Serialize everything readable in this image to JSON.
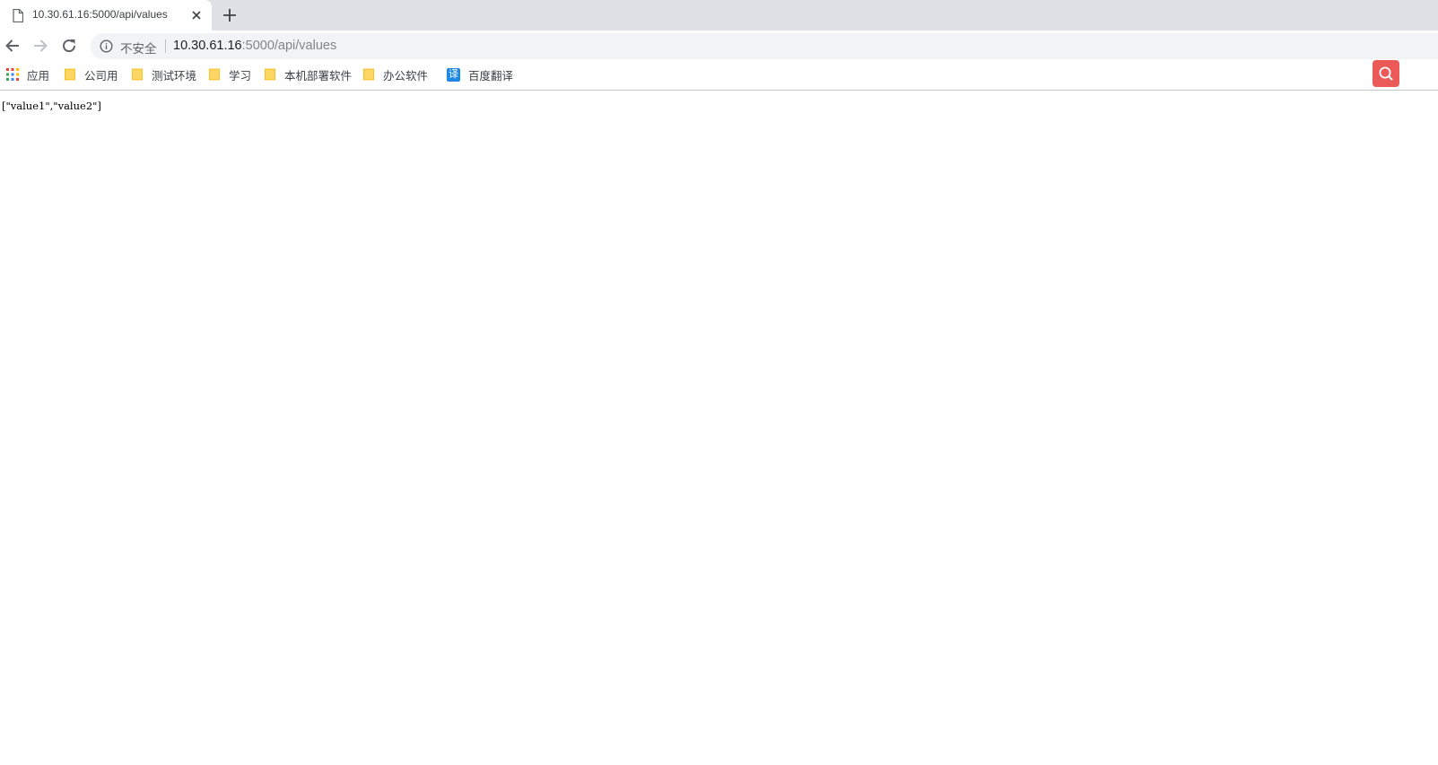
{
  "tab": {
    "title": "10.30.61.16:5000/api/values",
    "favicon": "page-icon",
    "close_icon": "close-icon"
  },
  "new_tab_icon": "plus-icon",
  "toolbar": {
    "back_icon": "back-arrow-icon",
    "forward_icon": "forward-arrow-icon",
    "reload_icon": "reload-icon"
  },
  "omnibox": {
    "info_icon": "info-icon",
    "security_label": "不安全",
    "url_host": "10.30.61.16",
    "url_path": ":5000/api/values"
  },
  "bookmarks": {
    "items": [
      {
        "label": "应用",
        "icon": "apps-grid-icon"
      },
      {
        "label": "公司用",
        "icon": "folder-icon"
      },
      {
        "label": "测试环境",
        "icon": "folder-icon"
      },
      {
        "label": "学习",
        "icon": "folder-icon"
      },
      {
        "label": "本机部署软件",
        "icon": "folder-icon"
      },
      {
        "label": "办公软件",
        "icon": "folder-icon"
      },
      {
        "label": "百度翻译",
        "icon": "translate-icon",
        "icon_text": "译"
      }
    ],
    "extension_icon": "search-icon"
  },
  "page": {
    "body_text": "[\"value1\",\"value2\"]"
  },
  "colors": {
    "tabstrip_bg": "#dee1e6",
    "omnibox_bg": "#f1f3f4",
    "folder_yellow": "#fdd663",
    "extension_red": "#ec5959",
    "translate_blue": "#1e88e5"
  }
}
